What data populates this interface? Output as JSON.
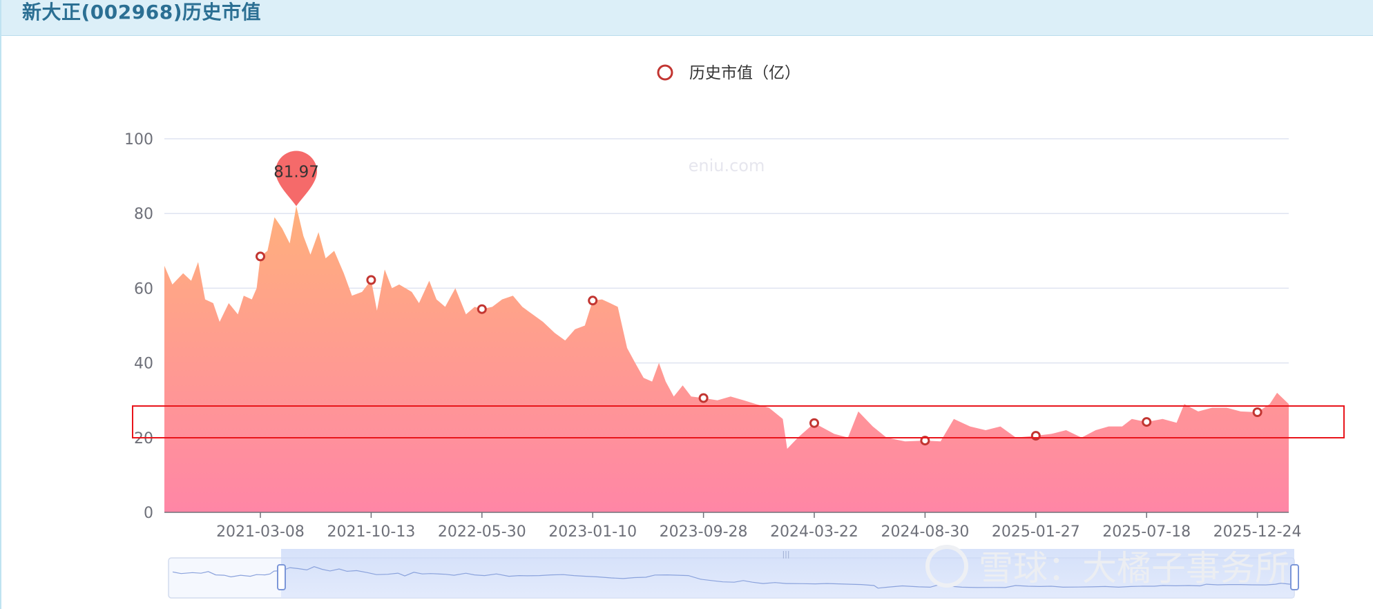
{
  "page": {
    "title": "新大正(002968)历史市值"
  },
  "legend": {
    "label": "历史市值（亿）",
    "marker_color": "#c23531"
  },
  "watermark": {
    "site": "eniu.com",
    "xueqiu": "雪球：大橘子事务所"
  },
  "peak_label": "81.97",
  "colors": {
    "area_top": "#ffb07c",
    "area_bottom": "#ff86a6",
    "grid": "#dfe3f0",
    "axis_text": "#6e7079",
    "highlight_box": "#e8141a",
    "pin": "#f56a6a"
  },
  "chart_data": {
    "type": "area",
    "title": "",
    "series_name": "历史市值（亿）",
    "ylim": [
      0,
      100
    ],
    "yticks": [
      0,
      20,
      40,
      60,
      80,
      100
    ],
    "x_tick_labels": [
      "2021-03-08",
      "2021-10-13",
      "2022-05-30",
      "2023-01-10",
      "2023-09-28",
      "2024-03-22",
      "2024-08-30",
      "2025-01-27",
      "2025-07-18",
      "2025-12-24"
    ],
    "grid": true,
    "legend_position": "top-center",
    "max_point": {
      "date": "2021-05-18",
      "value": 81.97
    },
    "markers": [
      {
        "date": "2021-03-08",
        "value": 68.5
      },
      {
        "date": "2021-10-13",
        "value": 62.2
      },
      {
        "date": "2022-05-30",
        "value": 54.4
      },
      {
        "date": "2023-01-10",
        "value": 56.7
      },
      {
        "date": "2023-09-28",
        "value": 30.6
      },
      {
        "date": "2024-03-22",
        "value": 23.9
      },
      {
        "date": "2024-08-30",
        "value": 19.2
      },
      {
        "date": "2025-01-27",
        "value": 20.5
      },
      {
        "date": "2025-07-18",
        "value": 24.2
      },
      {
        "date": "2025-12-24",
        "value": 26.8
      }
    ],
    "points": [
      [
        "2020-09-10",
        66
      ],
      [
        "2020-09-25",
        61
      ],
      [
        "2020-10-15",
        64
      ],
      [
        "2020-10-30",
        62
      ],
      [
        "2020-11-12",
        67
      ],
      [
        "2020-11-25",
        57
      ],
      [
        "2020-12-10",
        56
      ],
      [
        "2020-12-22",
        51
      ],
      [
        "2021-01-08",
        56
      ],
      [
        "2021-01-25",
        53
      ],
      [
        "2021-02-05",
        58
      ],
      [
        "2021-02-20",
        57
      ],
      [
        "2021-03-01",
        60
      ],
      [
        "2021-03-08",
        68.5
      ],
      [
        "2021-03-22",
        70
      ],
      [
        "2021-04-05",
        79
      ],
      [
        "2021-04-20",
        76
      ],
      [
        "2021-05-05",
        72
      ],
      [
        "2021-05-18",
        81.97
      ],
      [
        "2021-06-01",
        74
      ],
      [
        "2021-06-15",
        69
      ],
      [
        "2021-07-01",
        75
      ],
      [
        "2021-07-15",
        68
      ],
      [
        "2021-08-01",
        70
      ],
      [
        "2021-08-20",
        64
      ],
      [
        "2021-09-05",
        58
      ],
      [
        "2021-09-25",
        59
      ],
      [
        "2021-10-13",
        62.2
      ],
      [
        "2021-10-25",
        54
      ],
      [
        "2021-11-10",
        65
      ],
      [
        "2021-11-25",
        60
      ],
      [
        "2021-12-10",
        61
      ],
      [
        "2022-01-05",
        59
      ],
      [
        "2022-01-20",
        56
      ],
      [
        "2022-02-10",
        62
      ],
      [
        "2022-02-25",
        57
      ],
      [
        "2022-03-15",
        55
      ],
      [
        "2022-04-05",
        60
      ],
      [
        "2022-04-27",
        53
      ],
      [
        "2022-05-15",
        55
      ],
      [
        "2022-05-30",
        54.4
      ],
      [
        "2022-06-20",
        55
      ],
      [
        "2022-07-10",
        57
      ],
      [
        "2022-08-01",
        58
      ],
      [
        "2022-08-20",
        55
      ],
      [
        "2022-09-10",
        53
      ],
      [
        "2022-10-01",
        51
      ],
      [
        "2022-10-25",
        48
      ],
      [
        "2022-11-15",
        46
      ],
      [
        "2022-12-05",
        49
      ],
      [
        "2022-12-25",
        50
      ],
      [
        "2023-01-10",
        56.7
      ],
      [
        "2023-02-01",
        57
      ],
      [
        "2023-02-20",
        56
      ],
      [
        "2023-03-10",
        55
      ],
      [
        "2023-04-01",
        44
      ],
      [
        "2023-04-20",
        40
      ],
      [
        "2023-05-10",
        36
      ],
      [
        "2023-05-30",
        35
      ],
      [
        "2023-06-15",
        40
      ],
      [
        "2023-07-01",
        35
      ],
      [
        "2023-07-20",
        31
      ],
      [
        "2023-08-10",
        34
      ],
      [
        "2023-08-30",
        31
      ],
      [
        "2023-09-28",
        30.6
      ],
      [
        "2023-10-20",
        30
      ],
      [
        "2023-11-10",
        31
      ],
      [
        "2023-12-01",
        30
      ],
      [
        "2023-12-20",
        29
      ],
      [
        "2024-01-10",
        28
      ],
      [
        "2024-02-01",
        25
      ],
      [
        "2024-02-08",
        17
      ],
      [
        "2024-02-25",
        20
      ],
      [
        "2024-03-22",
        23.9
      ],
      [
        "2024-04-20",
        21
      ],
      [
        "2024-05-10",
        20
      ],
      [
        "2024-05-25",
        27
      ],
      [
        "2024-06-15",
        23
      ],
      [
        "2024-07-05",
        20
      ],
      [
        "2024-08-01",
        19
      ],
      [
        "2024-08-30",
        19.2
      ],
      [
        "2024-09-20",
        19
      ],
      [
        "2024-10-08",
        25
      ],
      [
        "2024-10-30",
        23
      ],
      [
        "2024-11-20",
        22
      ],
      [
        "2024-12-10",
        23
      ],
      [
        "2024-12-31",
        20
      ],
      [
        "2025-01-27",
        20.5
      ],
      [
        "2025-02-20",
        21
      ],
      [
        "2025-03-15",
        22
      ],
      [
        "2025-04-08",
        20
      ],
      [
        "2025-04-30",
        22
      ],
      [
        "2025-05-20",
        23
      ],
      [
        "2025-06-10",
        23
      ],
      [
        "2025-06-25",
        25
      ],
      [
        "2025-07-18",
        24.2
      ],
      [
        "2025-08-10",
        25
      ],
      [
        "2025-08-30",
        24
      ],
      [
        "2025-09-10",
        29
      ],
      [
        "2025-09-30",
        27
      ],
      [
        "2025-10-20",
        28
      ],
      [
        "2025-11-10",
        28
      ],
      [
        "2025-11-30",
        27
      ],
      [
        "2025-12-24",
        26.8
      ],
      [
        "2026-01-10",
        29
      ],
      [
        "2026-01-20",
        32
      ],
      [
        "2026-02-05",
        29
      ]
    ]
  }
}
